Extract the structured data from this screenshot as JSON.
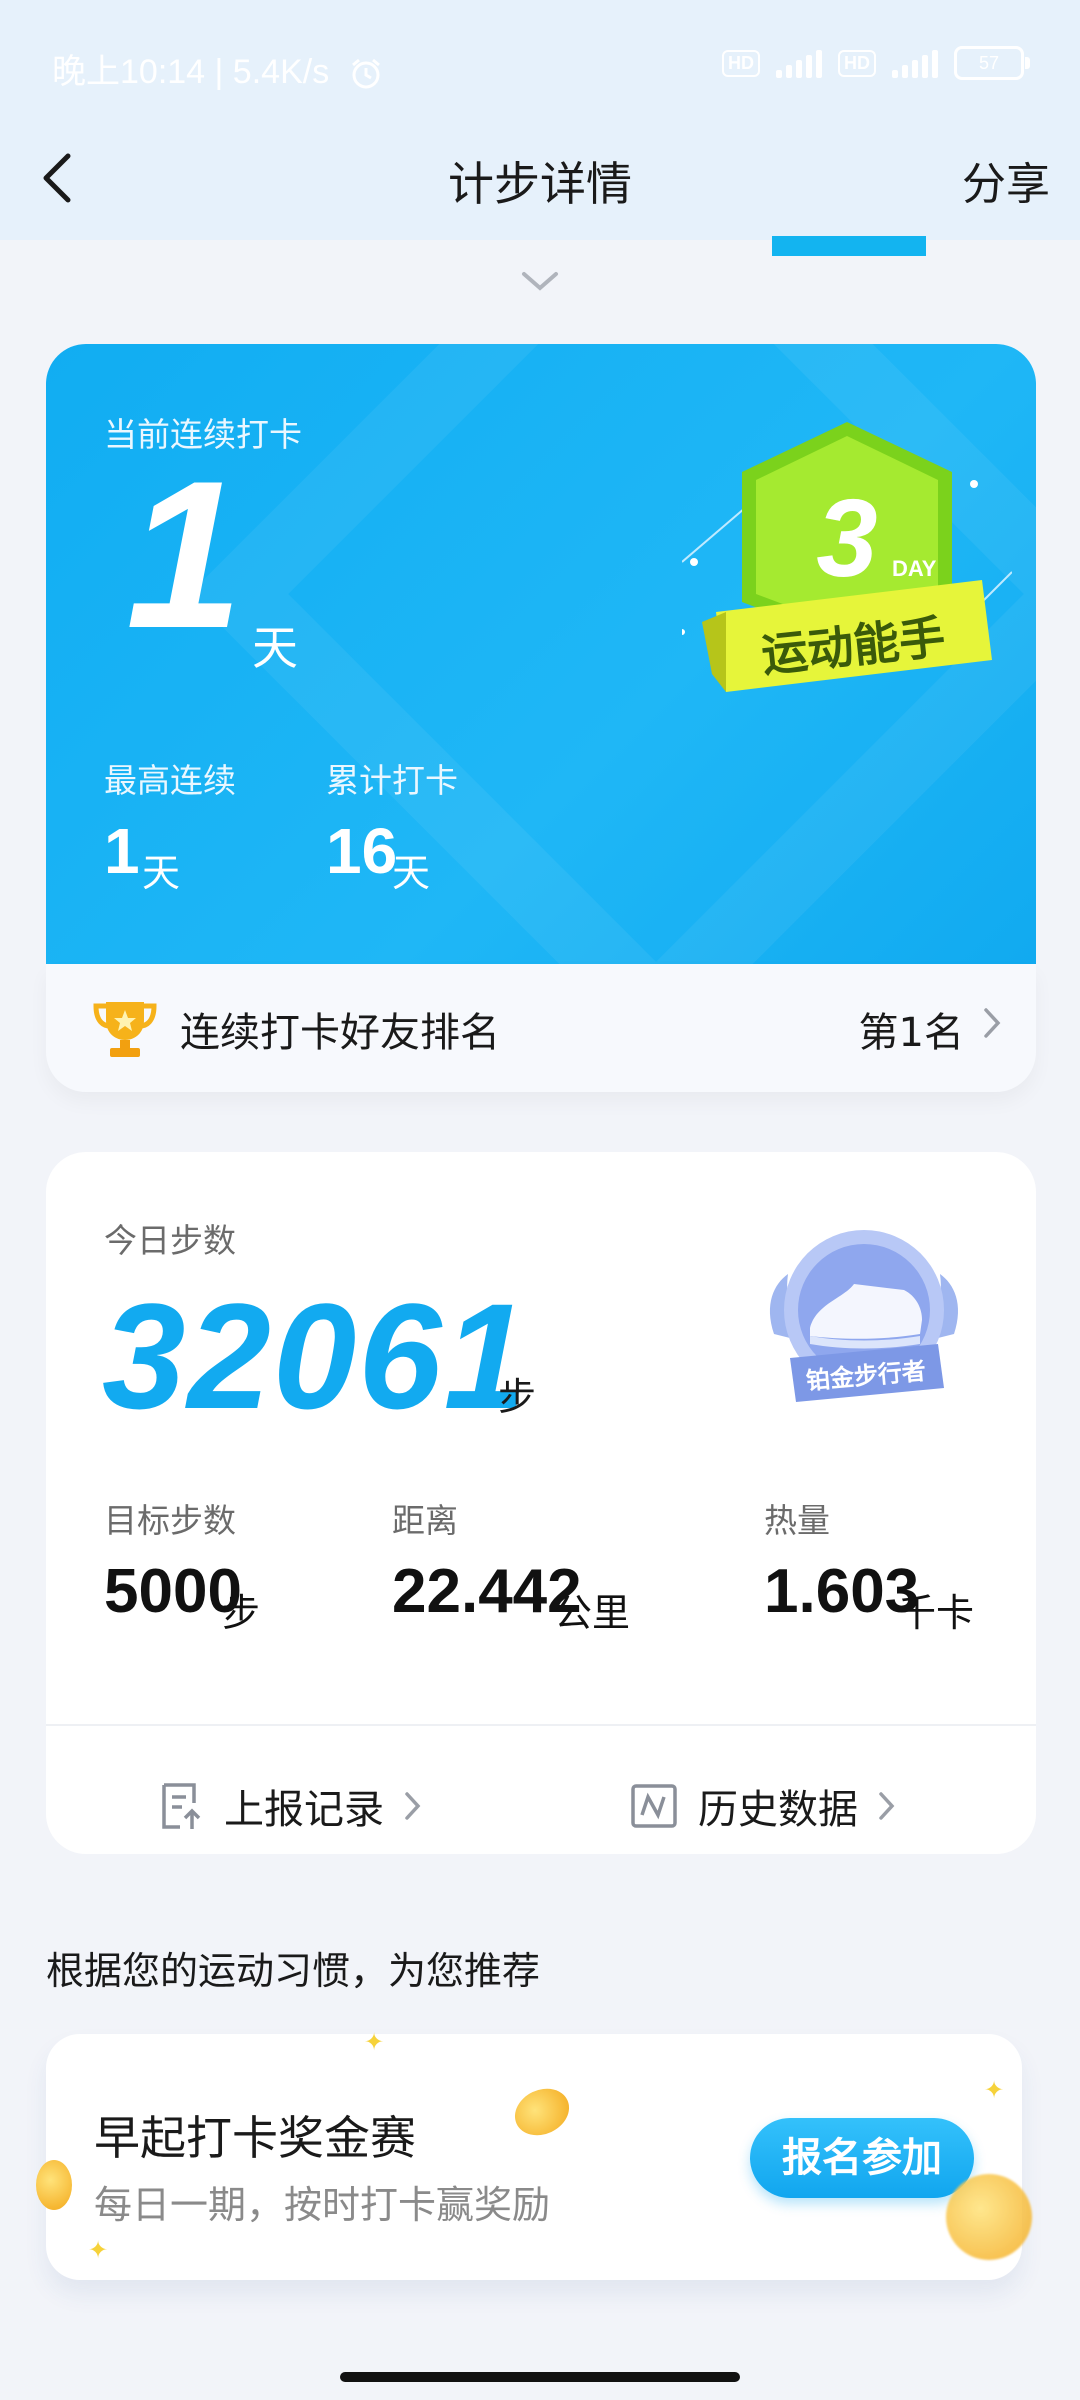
{
  "status_bar": {
    "time_speed": "晚上10:14 | 5.4K/s",
    "battery": "57"
  },
  "nav": {
    "title": "计步详情",
    "share": "分享"
  },
  "streak": {
    "label": "当前连续打卡",
    "current": "1",
    "unit": "天",
    "badge_title": "运动能手",
    "badge_days": "3",
    "badge_day_label": "DAY",
    "best_label": "最高连续",
    "best_value": "1",
    "best_unit": "天",
    "total_label": "累计打卡",
    "total_value": "16",
    "total_unit": "天"
  },
  "rank": {
    "label": "连续打卡好友排名",
    "position": "第1名"
  },
  "steps": {
    "label": "今日步数",
    "value": "32061",
    "unit": "步",
    "badge_text": "铂金步行者",
    "goal_label": "目标步数",
    "goal_value": "5000",
    "goal_unit": "步",
    "distance_label": "距离",
    "distance_value": "22.442",
    "distance_unit": "公里",
    "calorie_label": "热量",
    "calorie_value": "1.603",
    "calorie_unit": "千卡",
    "report_link": "上报记录",
    "history_link": "历史数据"
  },
  "recommend": {
    "title": "根据您的运动习惯，为您推荐",
    "card_title": "早起打卡奖金赛",
    "card_subtitle": "每日一期，按时打卡赢奖励",
    "button": "报名参加"
  },
  "colors": {
    "accent": "#12aaf0",
    "card_blue": "#1fb7f6",
    "badge_green": "#8be024"
  }
}
